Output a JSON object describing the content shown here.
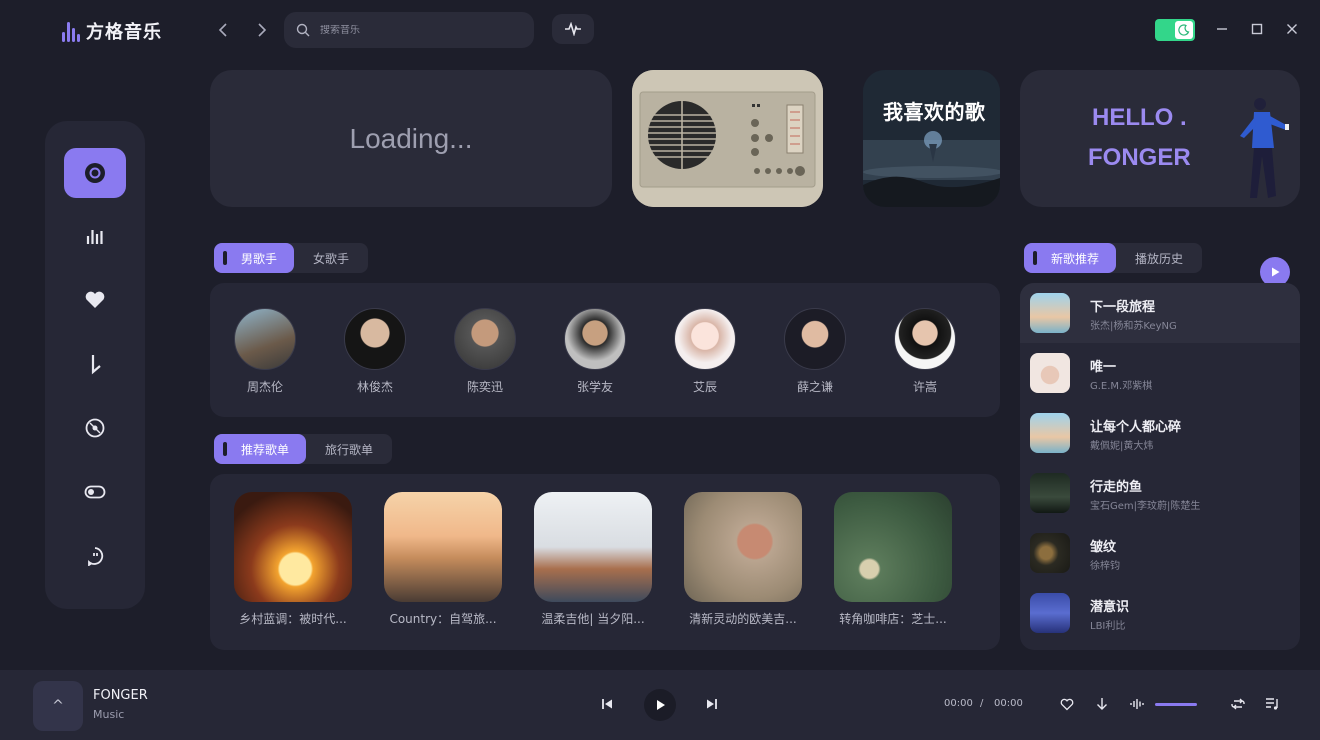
{
  "app": {
    "name": "方格音乐"
  },
  "search": {
    "placeholder": "搜索音乐"
  },
  "banner": {
    "loading": "Loading...",
    "song_card_title": "我喜欢的歌",
    "hello_line1": "HELLO .",
    "hello_line2": "FONGER"
  },
  "artist_tabs": [
    {
      "label": "男歌手",
      "active": true
    },
    {
      "label": "女歌手",
      "active": false
    }
  ],
  "artists": [
    {
      "name": "周杰伦"
    },
    {
      "name": "林俊杰"
    },
    {
      "name": "陈奕迅"
    },
    {
      "name": "张学友"
    },
    {
      "name": "艾辰"
    },
    {
      "name": "薛之谦"
    },
    {
      "name": "许嵩"
    }
  ],
  "playlist_tabs": [
    {
      "label": "推荐歌单",
      "active": true
    },
    {
      "label": "旅行歌单",
      "active": false
    }
  ],
  "playlists": [
    {
      "name": "乡村蓝调：被时代..."
    },
    {
      "name": "Country：自驾旅..."
    },
    {
      "name": "温柔吉他| 当夕阳..."
    },
    {
      "name": "清新灵动的欧美吉..."
    },
    {
      "name": "转角咖啡店：芝士..."
    }
  ],
  "song_tabs": [
    {
      "label": "新歌推荐",
      "active": true
    },
    {
      "label": "播放历史",
      "active": false
    }
  ],
  "songs": [
    {
      "title": "下一段旅程",
      "artist": "张杰|杨和苏KeyNG"
    },
    {
      "title": "唯一",
      "artist": "G.E.M.邓紫棋"
    },
    {
      "title": "让每个人都心碎",
      "artist": "戴佩妮|黄大炜"
    },
    {
      "title": "行走的鱼",
      "artist": "宝石Gem|李玟蔚|陈楚生"
    },
    {
      "title": "皱纹",
      "artist": "徐梓钧"
    },
    {
      "title": "潜意识",
      "artist": "LBI利比"
    }
  ],
  "player": {
    "thumb_icon": "^",
    "title": "FONGER",
    "subtitle": "Music",
    "current_time": "00:00",
    "separator": "/",
    "total_time": "00:00"
  },
  "colors": {
    "accent": "#8a7af0",
    "toggle": "#33d68a",
    "background": "#1d1e2a",
    "panel": "#262736"
  }
}
